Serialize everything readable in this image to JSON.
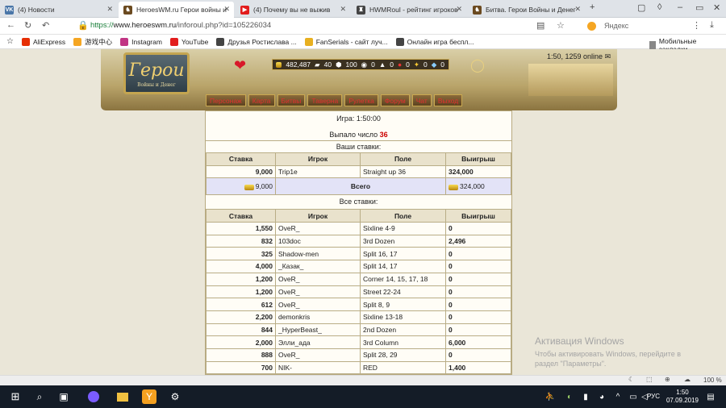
{
  "tabs": [
    {
      "label": "(4) Новости",
      "fav": "vk-icon",
      "color": "#4a76a8",
      "sym": "VK",
      "active": false
    },
    {
      "label": "HeroesWM.ru Герои войны и",
      "fav": "heroes-icon",
      "color": "#6b4a20",
      "sym": "♞",
      "active": true
    },
    {
      "label": "(4) Почему вы не выжив",
      "fav": "youtube-icon",
      "color": "#e21d1d",
      "sym": "▶",
      "active": false
    },
    {
      "label": "HWMRoul - рейтинг игроков",
      "fav": "hwmroul-icon",
      "color": "#444",
      "sym": "♜",
      "active": false
    },
    {
      "label": "Битва. Герои Войны и Денег",
      "fav": "heroes-icon",
      "color": "#6b4a20",
      "sym": "♞",
      "active": false
    }
  ],
  "url": {
    "scheme": "https://",
    "host": "www.heroeswm.ru",
    "path": "/inforoul.php?id=105226034"
  },
  "search_engine": "Яндекс",
  "bookmarks": [
    "AliExpress",
    "游戏中心",
    "Instagram",
    "YouTube",
    "Друзья Ростислава ...",
    "FanSerials - сайт луч...",
    "Онлайн игра беспл..."
  ],
  "bookmarks_right": "Мобильные закладки",
  "header": {
    "logo_title": "Герои",
    "logo_sub": "Войны и Денег",
    "online": "1:50, 1259 online",
    "res": [
      "482,487",
      "40",
      "100",
      "0",
      "0",
      "0",
      "0",
      "0"
    ],
    "menu": [
      "Персонаж",
      "Карта",
      "Битвы",
      "Таверна",
      "Рулетка",
      "Форум",
      "Чат",
      "Выход"
    ]
  },
  "game": {
    "time_label": "Игра: 1:50:00",
    "result_label": "Выпало число",
    "result_number": "36",
    "your_bets": "Ваши ставки:",
    "all_bets": "Все ставки:"
  },
  "columns": [
    "Ставка",
    "Игрок",
    "Поле",
    "Выигрыш"
  ],
  "my_bets": [
    {
      "stake": "9,000",
      "player": "Trip1e",
      "field": "Straight up 36",
      "win": "324,000"
    }
  ],
  "total": {
    "stake": "9,000",
    "label": "Всего",
    "win": "324,000"
  },
  "all_bets": [
    {
      "stake": "1,550",
      "player": "OveR_",
      "field": "Sixline 4-9",
      "win": "0"
    },
    {
      "stake": "832",
      "player": "103doc",
      "field": "3rd Dozen",
      "win": "2,496"
    },
    {
      "stake": "325",
      "player": "Shadow-men",
      "field": "Split 16, 17",
      "win": "0"
    },
    {
      "stake": "4,000",
      "player": "_Казак_",
      "field": "Split 14, 17",
      "win": "0"
    },
    {
      "stake": "1,200",
      "player": "OveR_",
      "field": "Corner 14, 15, 17, 18",
      "win": "0"
    },
    {
      "stake": "1,200",
      "player": "OveR_",
      "field": "Street 22-24",
      "win": "0"
    },
    {
      "stake": "612",
      "player": "OveR_",
      "field": "Split 8, 9",
      "win": "0"
    },
    {
      "stake": "2,200",
      "player": "demonkris",
      "field": "Sixline 13-18",
      "win": "0"
    },
    {
      "stake": "844",
      "player": "_HyperBeast_",
      "field": "2nd Dozen",
      "win": "0"
    },
    {
      "stake": "2,000",
      "player": "Элли_ада",
      "field": "3rd Column",
      "win": "6,000"
    },
    {
      "stake": "888",
      "player": "OveR_",
      "field": "Split 28, 29",
      "win": "0"
    },
    {
      "stake": "700",
      "player": "NIK-",
      "field": "RED",
      "win": "1,400"
    }
  ],
  "watermark": {
    "title": "Активация Windows",
    "line1": "Чтобы активировать Windows, перейдите в",
    "line2": "раздел \"Параметры\"."
  },
  "zoom": "100 %",
  "taskbar": {
    "lang": "РУС",
    "time": "1:50",
    "date": "07.09.2019"
  }
}
